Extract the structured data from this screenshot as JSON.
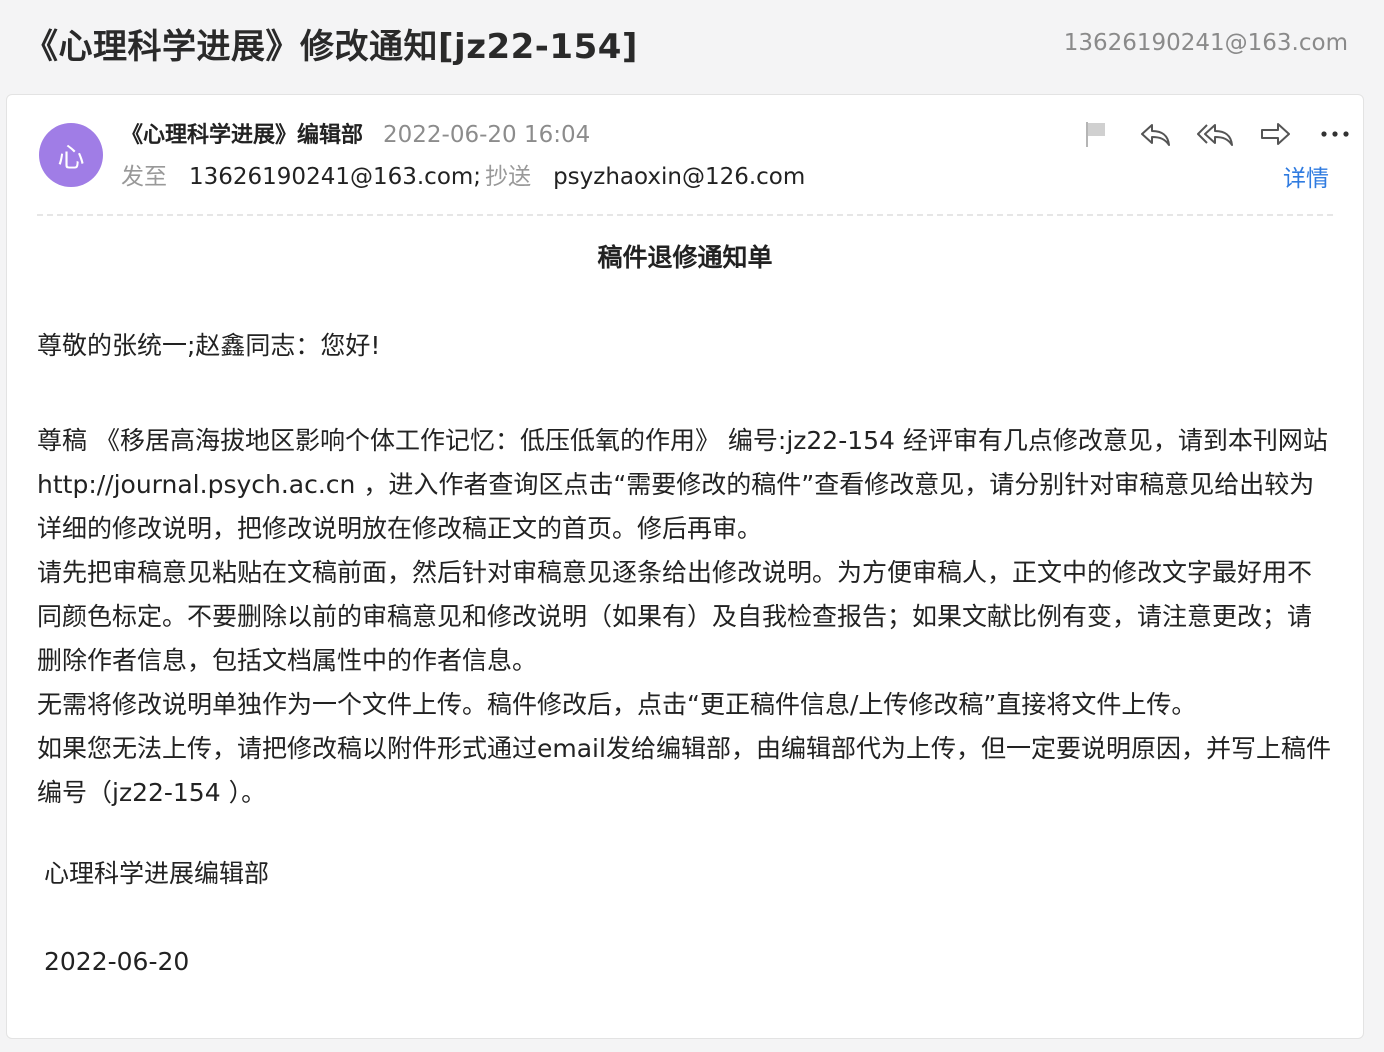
{
  "header": {
    "subject": "《心理科学进展》修改通知[jz22-154]",
    "account": "13626190241@163.com"
  },
  "message": {
    "avatar_char": "心",
    "sender": "《心理科学进展》编辑部",
    "date": "2022-06-20 16:04",
    "to_label": "发至",
    "to": "13626190241@163.com;",
    "cc_label": "抄送",
    "cc": "psyzhaoxin@126.com",
    "details_label": "详情",
    "actions": [
      "flag-icon",
      "reply-icon",
      "reply-all-icon",
      "forward-icon",
      "more-icon"
    ]
  },
  "content": {
    "title": "稿件退修通知单",
    "greeting": "尊敬的张统一;赵鑫同志：您好!",
    "paragraphs": [
      "尊稿 《移居高海拔地区影响个体工作记忆：低压低氧的作用》 编号:jz22-154 经评审有几点修改意见，请到本刊网站http://journal.psych.ac.cn ，进入作者查询区点击“需要修改的稿件”查看修改意见，请分别针对审稿意见给出较为详细的修改说明，把修改说明放在修改稿正文的首页。修后再审。",
      "请先把审稿意见粘贴在文稿前面，然后针对审稿意见逐条给出修改说明。为方便审稿人，正文中的修改文字最好用不同颜色标定。不要删除以前的审稿意见和修改说明（如果有）及自我检查报告；如果文献比例有变，请注意更改；请删除作者信息，包括文档属性中的作者信息。",
      "无需将修改说明单独作为一个文件上传。稿件修改后，点击“更正稿件信息/上传修改稿”直接将文件上传。",
      "如果您无法上传，请把修改稿以附件形式通过email发给编辑部，由编辑部代为上传，但一定要说明原因，并写上稿件编号（jz22-154 ）。"
    ],
    "signature": "心理科学进展编辑部",
    "signature_date": "2022-06-20"
  },
  "colors": {
    "avatar": "#a07de6",
    "link": "#2f7be0",
    "muted": "#8c8c8c"
  }
}
